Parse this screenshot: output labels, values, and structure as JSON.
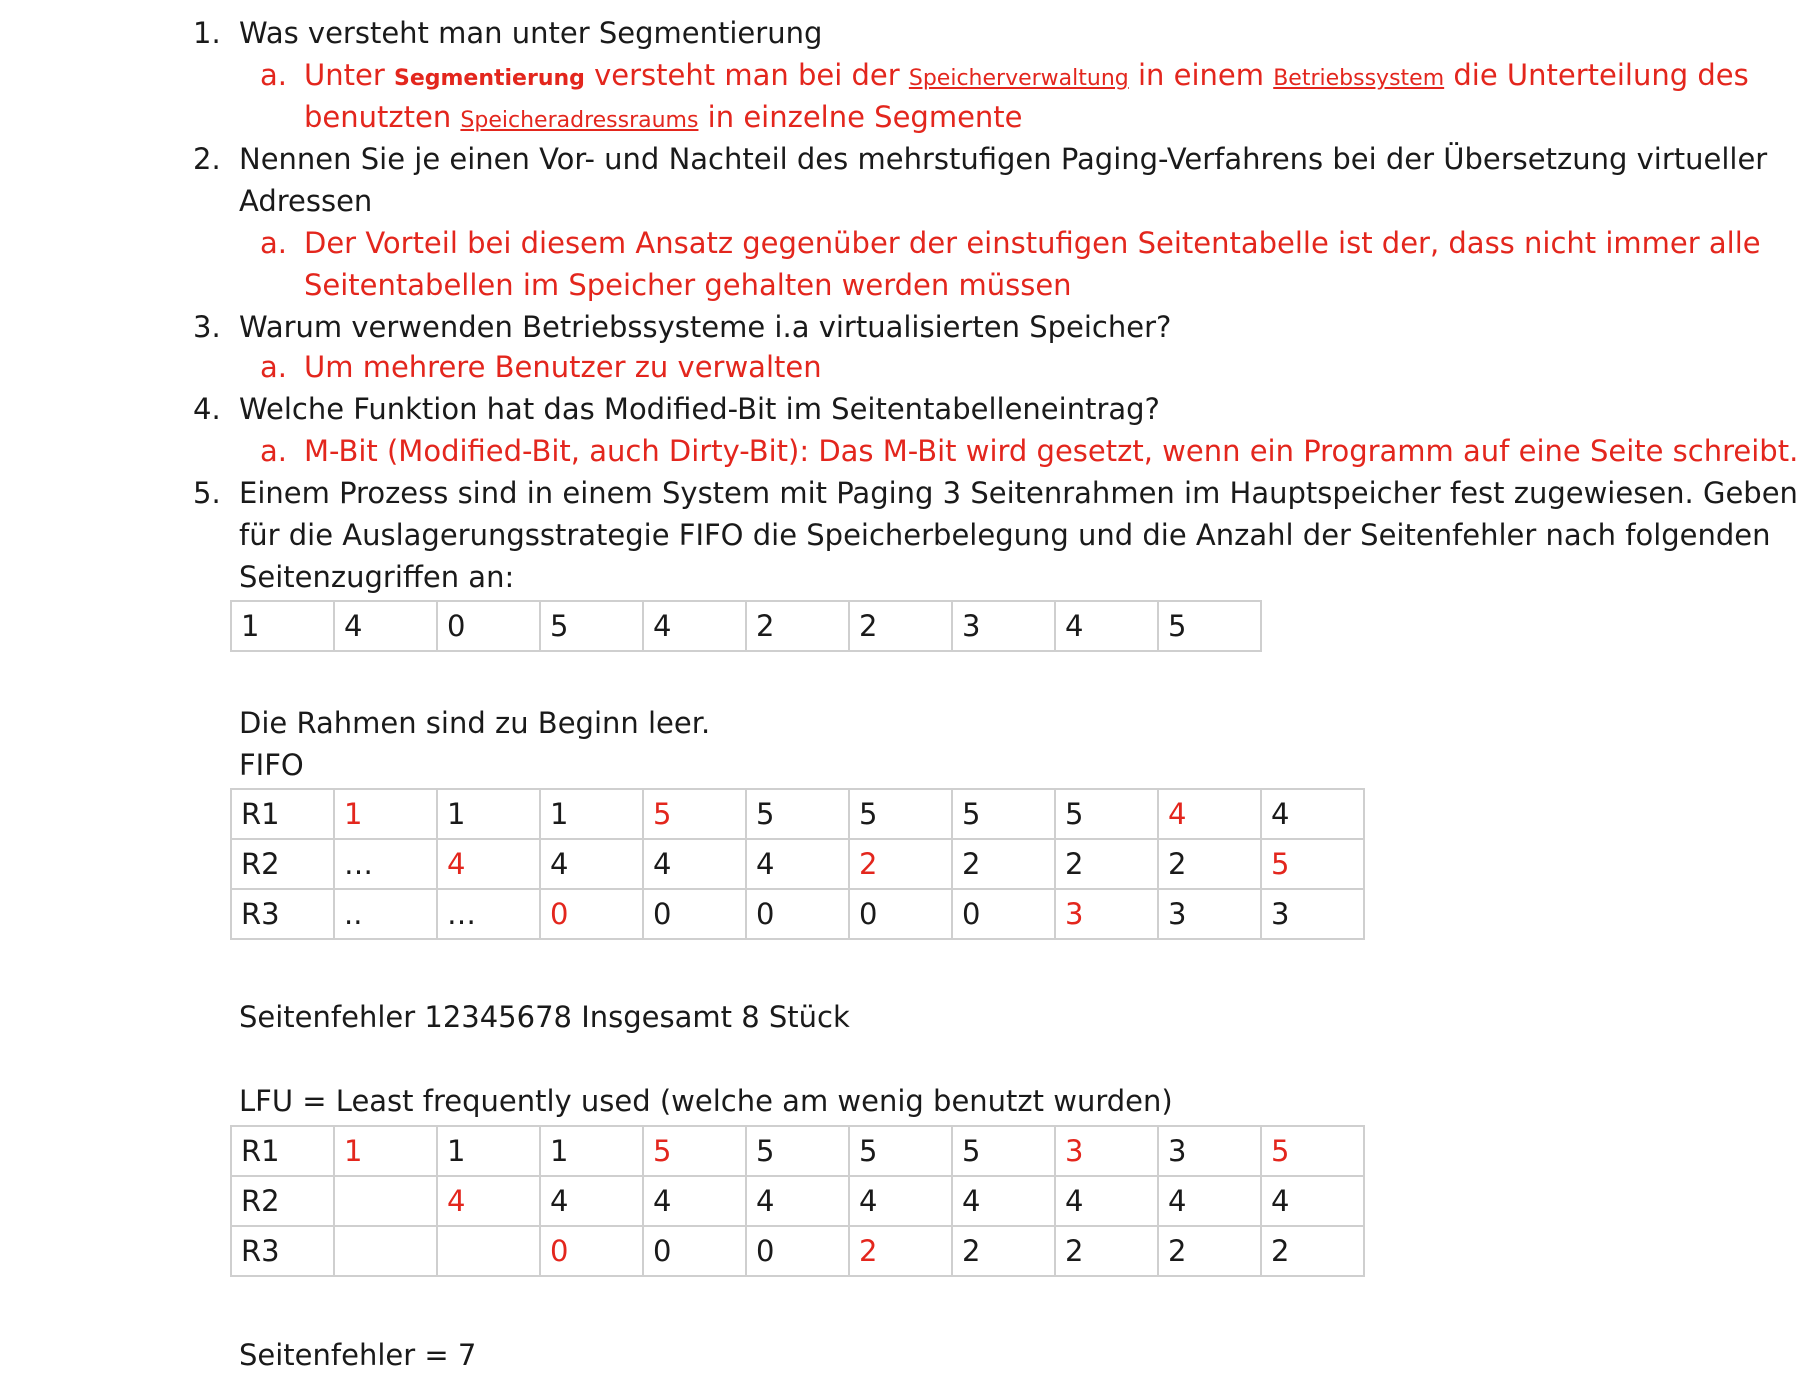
{
  "questions": [
    {
      "num": "1.",
      "text": "Was versteht man unter Segmentierung"
    },
    {
      "num": "2.",
      "line1": "Nennen Sie je einen Vor- und Nachteil des mehrstufigen Paging-Verfahrens bei der Übersetzung virtueller",
      "line2": "Adressen"
    },
    {
      "num": "3.",
      "text": "Warum verwenden Betriebssysteme i.a virtualisierten Speicher?"
    },
    {
      "num": "4.",
      "text": "Welche Funktion hat das Modified-Bit im Seitentabelleneintrag?"
    },
    {
      "num": "5.",
      "line1": "Einem Prozess sind in einem System mit Paging 3 Seitenrahmen im Hauptspeicher fest zugewiesen. Geben Sie",
      "line2": "für die Auslagerungsstrategie FIFO die Speicherbelegung und die Anzahl der Seitenfehler nach folgenden",
      "line3": "Seitenzugriffen an:"
    }
  ],
  "answers": {
    "a1": {
      "num": "a.",
      "p1": "Unter ",
      "b1": "Segmentierung",
      "p2": " versteht man bei der ",
      "u1": "Speicherverwaltung",
      "p3": " in einem ",
      "u2": "Betriebssystem",
      "p4": " die Unterteilung des",
      "p5": "benutzten ",
      "u3": "Speicheradressraums",
      "p6": " in einzelne Segmente"
    },
    "a2": {
      "num": "a.",
      "line1": "Der Vorteil bei diesem Ansatz gegenüber der einstufigen Seitentabelle ist der, dass nicht immer alle",
      "line2": "Seitentabellen im Speicher gehalten werden müssen"
    },
    "a3": {
      "num": "a.",
      "text": "Um mehrere Benutzer zu verwalten"
    },
    "a4": {
      "num": "a.",
      "text": "M-Bit (Modified-Bit, auch Dirty-Bit): Das M-Bit wird gesetzt, wenn ein Programm auf eine Seite schreibt."
    }
  },
  "access_sequence": [
    "1",
    "4",
    "0",
    "5",
    "4",
    "2",
    "2",
    "3",
    "4",
    "5"
  ],
  "empty_note": "Die Rahmen sind zu Beginn leer.",
  "fifo_label": "FIFO",
  "fifo_table": [
    [
      {
        "t": "R1",
        "r": 0
      },
      {
        "t": "1",
        "r": 1
      },
      {
        "t": "1",
        "r": 0
      },
      {
        "t": "1",
        "r": 0
      },
      {
        "t": "5",
        "r": 1
      },
      {
        "t": "5",
        "r": 0
      },
      {
        "t": "5",
        "r": 0
      },
      {
        "t": "5",
        "r": 0
      },
      {
        "t": "5",
        "r": 0
      },
      {
        "t": "4",
        "r": 1
      },
      {
        "t": "4",
        "r": 0
      }
    ],
    [
      {
        "t": "R2",
        "r": 0
      },
      {
        "t": "…",
        "r": 0
      },
      {
        "t": "4",
        "r": 1
      },
      {
        "t": "4",
        "r": 0
      },
      {
        "t": "4",
        "r": 0
      },
      {
        "t": "4",
        "r": 0
      },
      {
        "t": "2",
        "r": 1
      },
      {
        "t": "2",
        "r": 0
      },
      {
        "t": "2",
        "r": 0
      },
      {
        "t": "2",
        "r": 0
      },
      {
        "t": "5",
        "r": 1
      }
    ],
    [
      {
        "t": "R3",
        "r": 0
      },
      {
        "t": "..",
        "r": 0
      },
      {
        "t": "…",
        "r": 0
      },
      {
        "t": "0",
        "r": 1
      },
      {
        "t": "0",
        "r": 0
      },
      {
        "t": "0",
        "r": 0
      },
      {
        "t": "0",
        "r": 0
      },
      {
        "t": "0",
        "r": 0
      },
      {
        "t": "3",
        "r": 1
      },
      {
        "t": "3",
        "r": 0
      },
      {
        "t": "3",
        "r": 0
      }
    ]
  ],
  "fifo_result": "Seitenfehler 12345678 Insgesamt 8 Stück",
  "lfu_label": "LFU = Least frequently used (welche am wenig benutzt wurden)",
  "lfu_table": [
    [
      {
        "t": "R1",
        "r": 0
      },
      {
        "t": "1",
        "r": 1
      },
      {
        "t": "1",
        "r": 0
      },
      {
        "t": "1",
        "r": 0
      },
      {
        "t": "5",
        "r": 1
      },
      {
        "t": "5",
        "r": 0
      },
      {
        "t": "5",
        "r": 0
      },
      {
        "t": "5",
        "r": 0
      },
      {
        "t": "3",
        "r": 1
      },
      {
        "t": "3",
        "r": 0
      },
      {
        "t": "5",
        "r": 1
      }
    ],
    [
      {
        "t": "R2",
        "r": 0
      },
      {
        "t": "",
        "r": 0
      },
      {
        "t": "4",
        "r": 1
      },
      {
        "t": "4",
        "r": 0
      },
      {
        "t": "4",
        "r": 0
      },
      {
        "t": "4",
        "r": 0
      },
      {
        "t": "4",
        "r": 0
      },
      {
        "t": "4",
        "r": 0
      },
      {
        "t": "4",
        "r": 0
      },
      {
        "t": "4",
        "r": 0
      },
      {
        "t": "4",
        "r": 0
      }
    ],
    [
      {
        "t": "R3",
        "r": 0
      },
      {
        "t": "",
        "r": 0
      },
      {
        "t": "",
        "r": 0
      },
      {
        "t": "0",
        "r": 1
      },
      {
        "t": "0",
        "r": 0
      },
      {
        "t": "0",
        "r": 0
      },
      {
        "t": "2",
        "r": 1
      },
      {
        "t": "2",
        "r": 0
      },
      {
        "t": "2",
        "r": 0
      },
      {
        "t": "2",
        "r": 0
      },
      {
        "t": "2",
        "r": 0
      }
    ]
  ],
  "lfu_result": "Seitenfehler = 7",
  "colors": {
    "answer": "#e3261d",
    "text": "#1a1a1a",
    "grid": "#cfcfcf"
  }
}
